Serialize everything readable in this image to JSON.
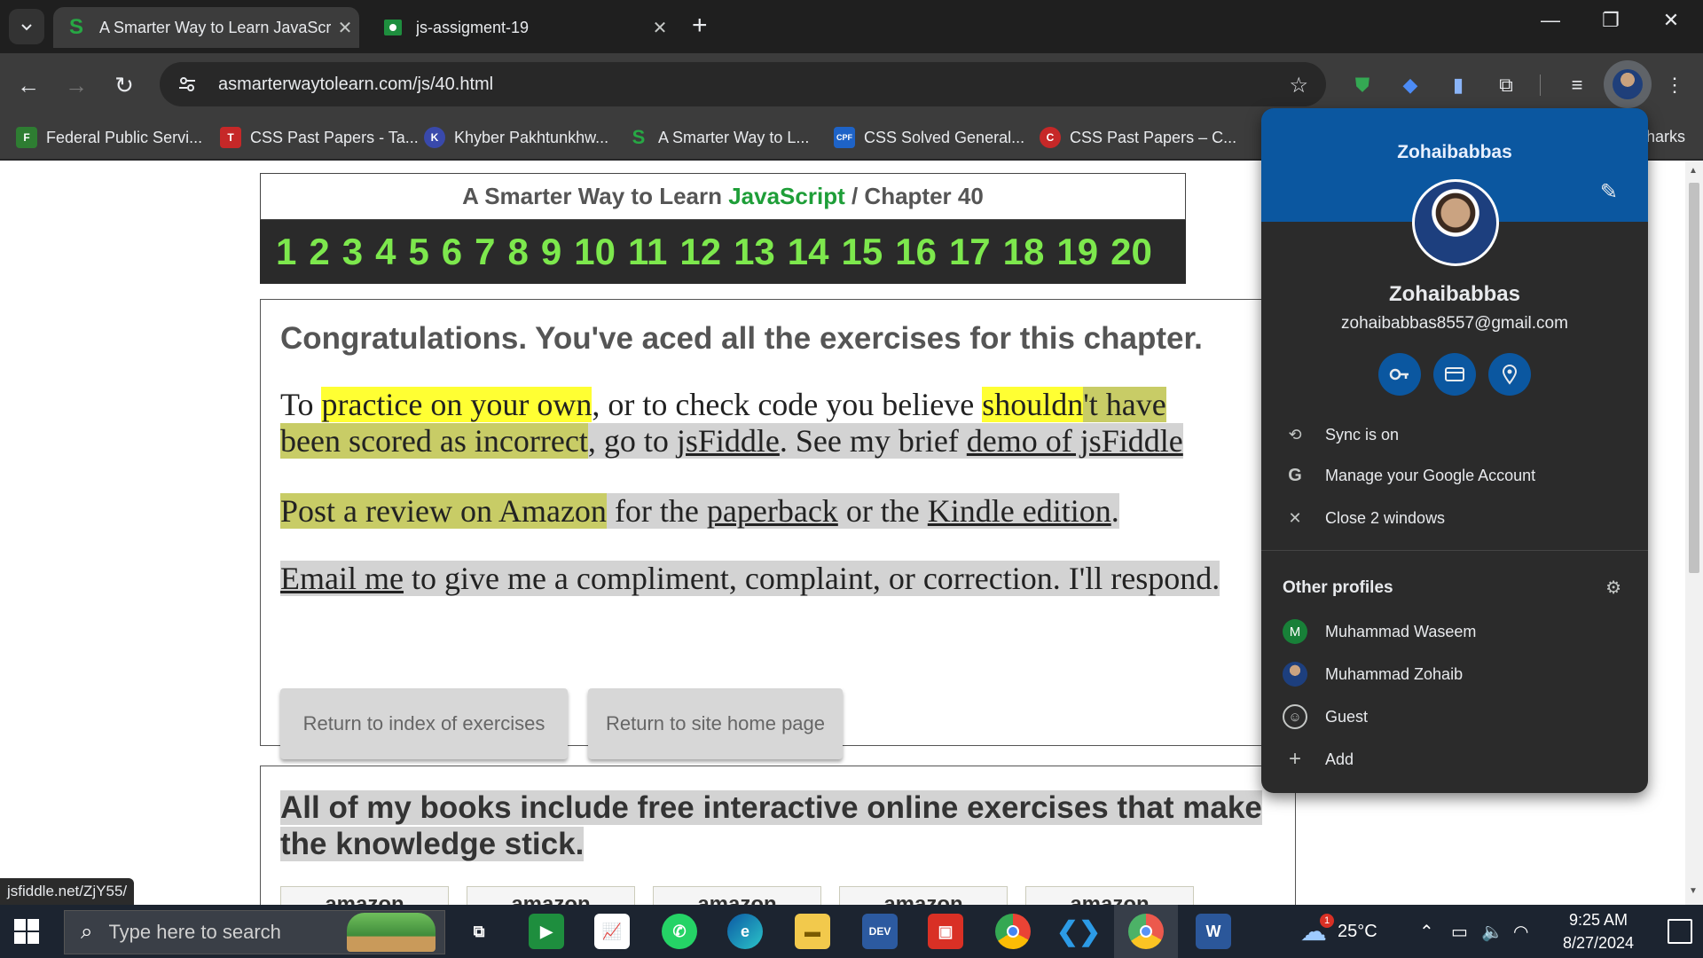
{
  "browser": {
    "tabs": [
      {
        "title": "A Smarter Way to Learn JavaScr",
        "active": true,
        "favicon": "S"
      },
      {
        "title": "js-assigment-19",
        "active": false,
        "favicon": "classroom-icon"
      }
    ],
    "url": "asmarterwaytolearn.com/js/40.html",
    "bookmarks": [
      {
        "label": "Federal Public Servi...",
        "icon_color": "#2e7d32",
        "icon_text": "F"
      },
      {
        "label": "CSS Past Papers - Ta...",
        "icon_color": "#c62828",
        "icon_text": "T"
      },
      {
        "label": "Khyber Pakhtunkhw...",
        "icon_color": "#3949ab",
        "icon_text": "K"
      },
      {
        "label": "A Smarter Way to L...",
        "icon_color": "#2e7d32",
        "icon_text": "S"
      },
      {
        "label": "CSS Solved General...",
        "icon_color": "#1e63c7",
        "icon_text": "CPF"
      },
      {
        "label": "CSS Past Papers – C...",
        "icon_color": "#c62828",
        "icon_text": "C"
      }
    ],
    "bookmarks_overflow": "harks",
    "status_url": "jsfiddle.net/ZjY55/"
  },
  "page": {
    "header_prefix": "A Smarter Way to Learn ",
    "header_js": "JavaScript",
    "header_suffix": "  /  Chapter 40",
    "numbers": [
      "1",
      "2",
      "3",
      "4",
      "5",
      "6",
      "7",
      "8",
      "9",
      "10",
      "11",
      "12",
      "13",
      "14",
      "15",
      "16",
      "17",
      "18",
      "19",
      "20"
    ],
    "congrats": "Congratulations. You've aced all the exercises for this chapter.",
    "p1": {
      "a": "To ",
      "b": "practice on your own",
      "c": ", or to check code you believe ",
      "d": "shouldn",
      "e": "'t have",
      "f": "been scored as incorrect",
      "g": ", go to ",
      "h": "jsFiddle",
      "i": ". See my brief ",
      "j": "demo of jsFiddle"
    },
    "p2": {
      "a": "Post a review on Amazon",
      "b": " for the ",
      "c": "paperback",
      "d": " or the ",
      "e": "Kindle edition",
      "f": "."
    },
    "p3": {
      "a": "Email me",
      "b": " to give me a compliment, complaint, or correction. I'll respond."
    },
    "btn_index": "Return to index of exercises",
    "btn_home": "Return to site home page",
    "books_text": " All of my books include free interactive online exercises that make the knowledge stick.",
    "amazon_label": "amazon"
  },
  "profile": {
    "header_name": "Zohaibabbas",
    "name": "Zohaibabbas",
    "email": "zohaibabbas8557@gmail.com",
    "sync": "Sync is on",
    "manage": "Manage your Google Account",
    "close": "Close 2 windows",
    "other_profiles_title": "Other profiles",
    "others": [
      {
        "name": "Muhammad Waseem",
        "initial": "M",
        "color": "#188038"
      },
      {
        "name": "Muhammad Zohaib",
        "initial": "",
        "color": "#1d3f7e"
      },
      {
        "name": "Guest",
        "initial": "",
        "color": "transparent"
      }
    ],
    "add": "Add"
  },
  "taskbar": {
    "search_placeholder": "Type here to search",
    "weather": "25°C",
    "weather_badge": "1",
    "time": "9:25 AM",
    "date": "8/27/2024"
  }
}
